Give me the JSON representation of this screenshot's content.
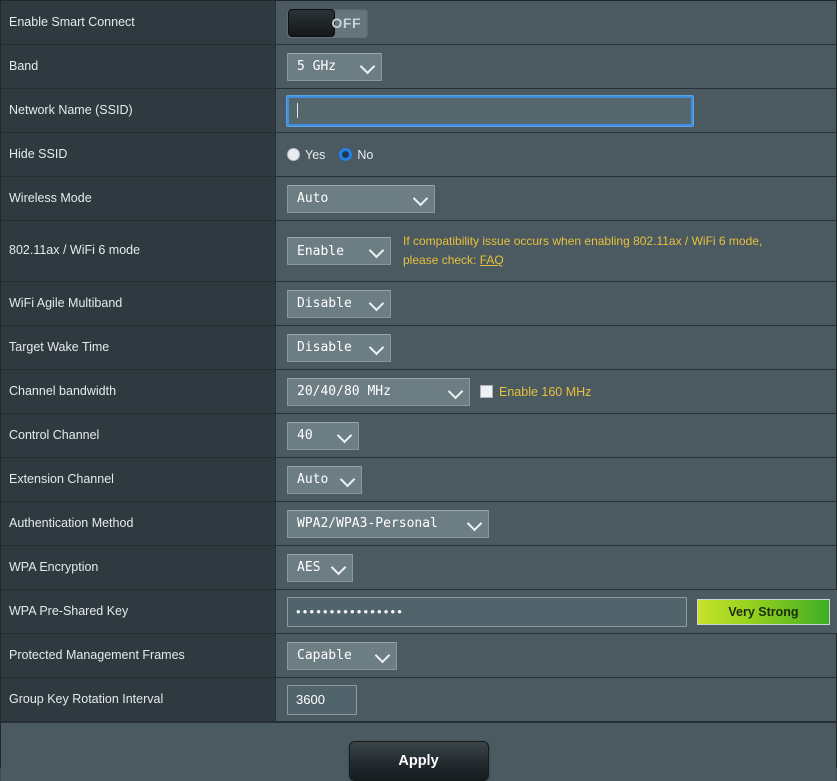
{
  "rows": {
    "smart_connect": {
      "label": "Enable Smart Connect",
      "toggle_state": "OFF"
    },
    "band": {
      "label": "Band",
      "value": "5 GHz"
    },
    "ssid": {
      "label": "Network Name (SSID)",
      "value": "",
      "placeholder": ""
    },
    "hide_ssid": {
      "label": "Hide SSID",
      "option_yes": "Yes",
      "option_no": "No",
      "selected": "No"
    },
    "wireless_mode": {
      "label": "Wireless Mode",
      "value": "Auto"
    },
    "ax_mode": {
      "label": "802.11ax / WiFi 6 mode",
      "value": "Enable",
      "hint_line1": "If compatibility issue occurs when enabling 802.11ax / WiFi 6 mode,",
      "hint_line2_prefix": "please check: ",
      "hint_link": "FAQ"
    },
    "agile_multiband": {
      "label": "WiFi Agile Multiband",
      "value": "Disable"
    },
    "target_wake_time": {
      "label": "Target Wake Time",
      "value": "Disable"
    },
    "channel_bandwidth": {
      "label": "Channel bandwidth",
      "value": "20/40/80 MHz",
      "checkbox_label": "Enable 160 MHz",
      "checkbox_checked": false
    },
    "control_channel": {
      "label": "Control Channel",
      "value": "40"
    },
    "extension_channel": {
      "label": "Extension Channel",
      "value": "Auto"
    },
    "auth_method": {
      "label": "Authentication Method",
      "value": "WPA2/WPA3-Personal"
    },
    "wpa_encryption": {
      "label": "WPA Encryption",
      "value": "AES"
    },
    "wpa_psk": {
      "label": "WPA Pre-Shared Key",
      "masked_value": "••••••••••••••••",
      "strength_badge": "Very Strong"
    },
    "pmf": {
      "label": "Protected Management Frames",
      "value": "Capable"
    },
    "group_key_rotation": {
      "label": "Group Key Rotation Interval",
      "value": "3600"
    }
  },
  "footer": {
    "apply_label": "Apply"
  },
  "colors": {
    "label_column_bg": "#2f3a40",
    "value_column_bg": "#4a5a60",
    "accent_warning": "#e8c03c",
    "accent_focus": "#3f8fe0",
    "radio_selected": "#1e80e8",
    "strength_gradient_start": "#c7e32a",
    "strength_gradient_end": "#3fae22"
  }
}
